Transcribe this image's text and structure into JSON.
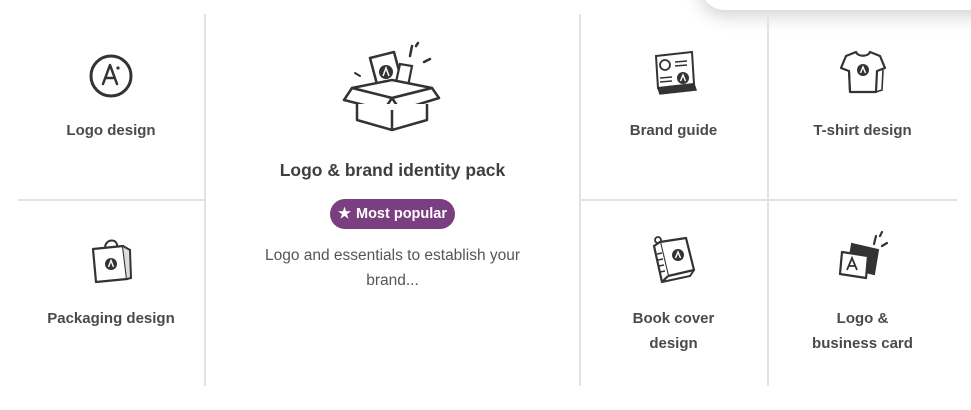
{
  "cards": {
    "logo_design": {
      "label": "Logo design",
      "icon": "logo-badge-icon"
    },
    "packaging_design": {
      "label": "Packaging design",
      "icon": "shopping-bag-icon"
    },
    "brand_pack": {
      "title": "Logo & brand identity pack",
      "badge": "Most popular",
      "badge_icon": "star-icon",
      "description": "Logo and essentials to establish your brand...",
      "icon": "open-box-icon"
    },
    "brand_guide": {
      "label": "Brand guide",
      "icon": "brand-guide-book-icon"
    },
    "tshirt_design": {
      "label": "T-shirt design",
      "icon": "tshirt-icon"
    },
    "book_cover_design": {
      "label": "Book cover design",
      "icon": "book-icon"
    },
    "logo_business_card": {
      "label": "Logo & business card",
      "icon": "business-card-icon"
    }
  },
  "colors": {
    "accent": "#7a3f80",
    "divider": "#e2e2e2",
    "icon_stroke": "#333333"
  }
}
